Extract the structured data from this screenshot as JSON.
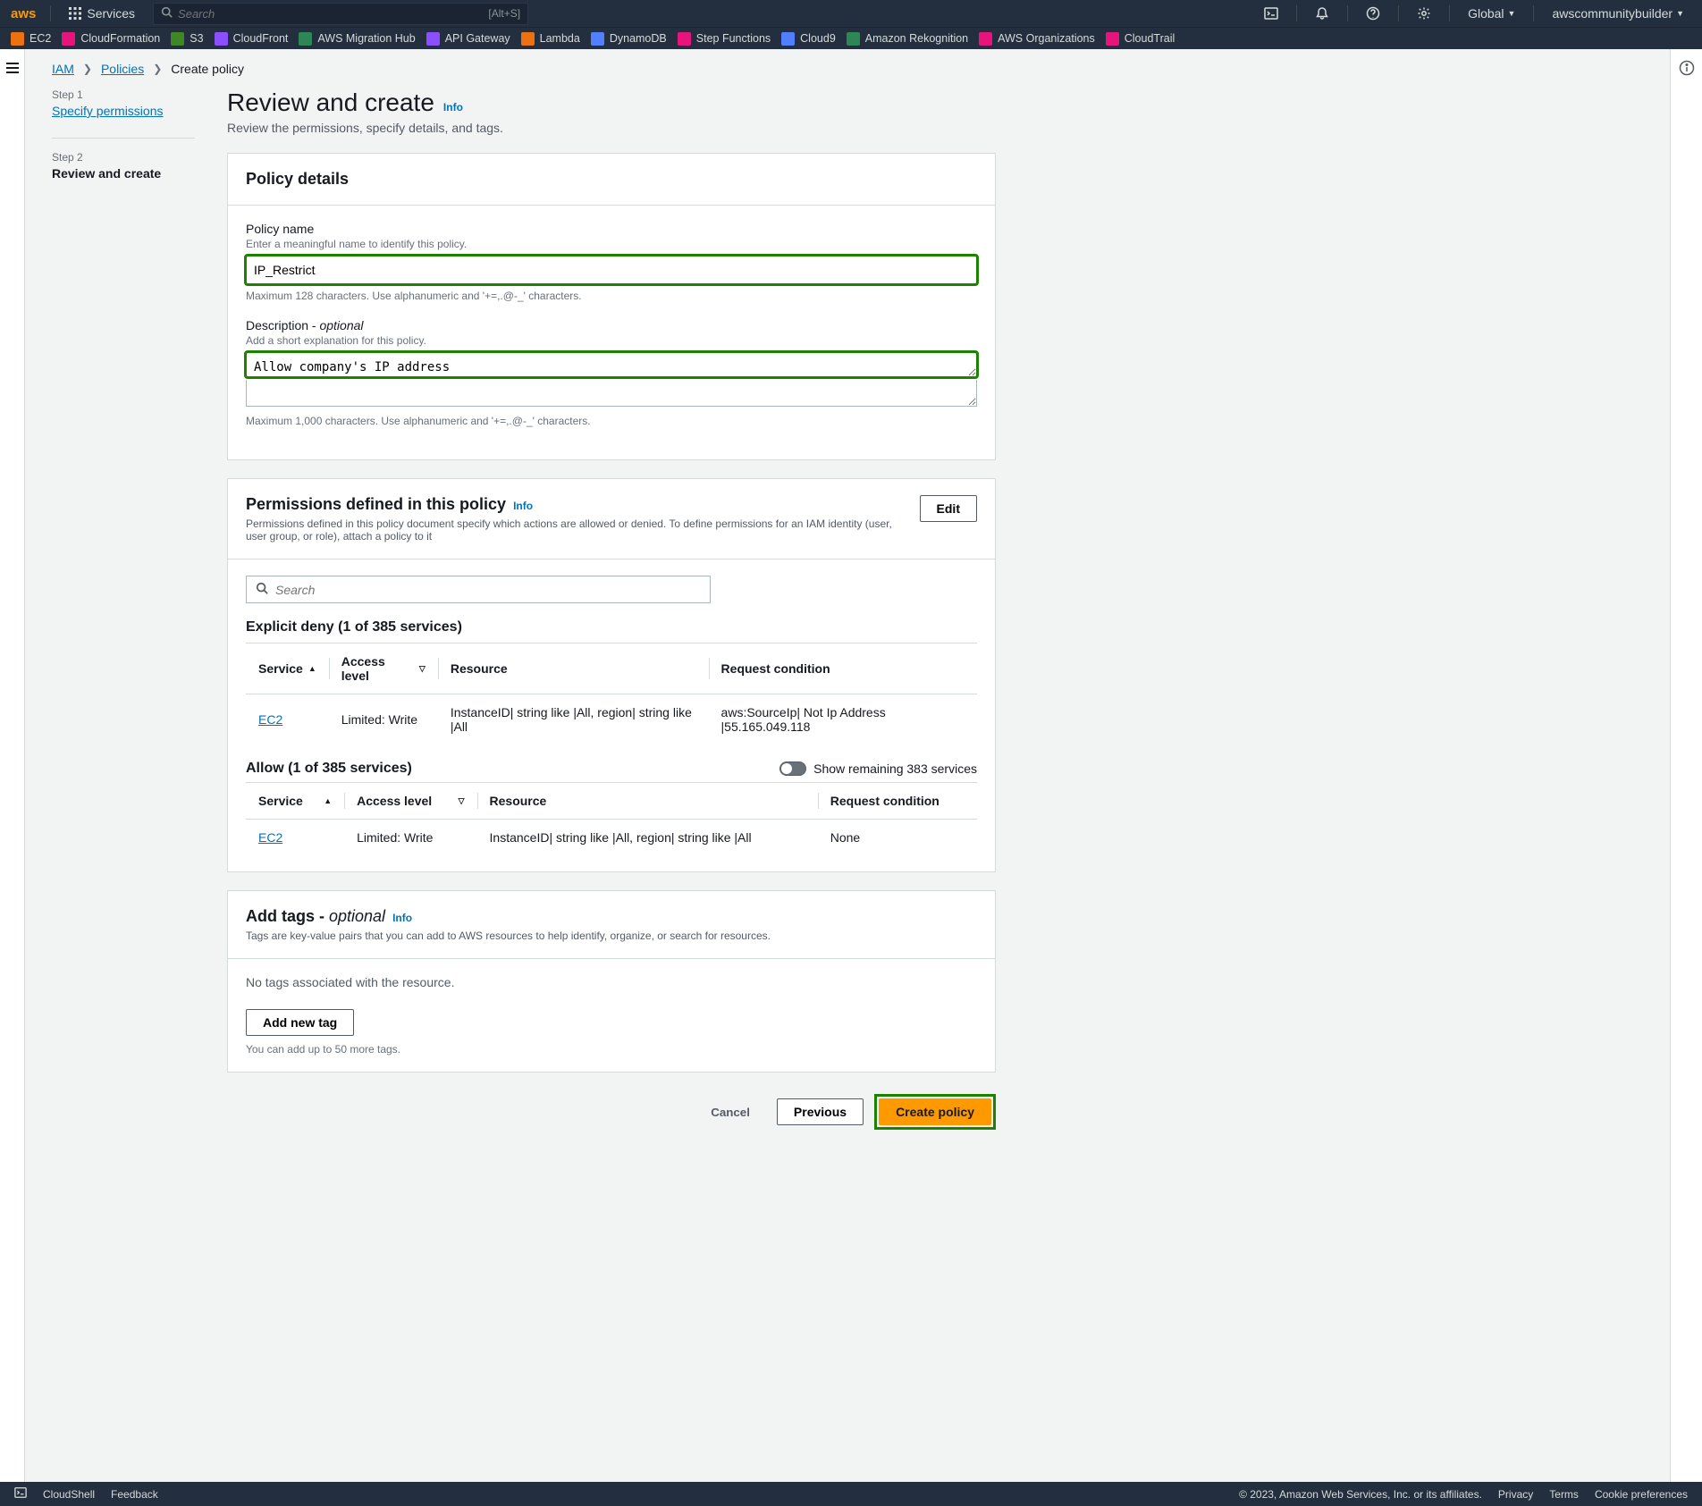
{
  "topnav": {
    "logo": "aws",
    "services": "Services",
    "search_placeholder": "Search",
    "search_shortcut": "[Alt+S]",
    "region": "Global",
    "account": "awscommunitybuilder"
  },
  "favbar": [
    {
      "label": "EC2",
      "color": "#ec7211"
    },
    {
      "label": "CloudFormation",
      "color": "#e7157b"
    },
    {
      "label": "S3",
      "color": "#3f8624"
    },
    {
      "label": "CloudFront",
      "color": "#8c4fff"
    },
    {
      "label": "AWS Migration Hub",
      "color": "#2e8555"
    },
    {
      "label": "API Gateway",
      "color": "#8c4fff"
    },
    {
      "label": "Lambda",
      "color": "#ec7211"
    },
    {
      "label": "DynamoDB",
      "color": "#527fff"
    },
    {
      "label": "Step Functions",
      "color": "#e7157b"
    },
    {
      "label": "Cloud9",
      "color": "#527fff"
    },
    {
      "label": "Amazon Rekognition",
      "color": "#2e8555"
    },
    {
      "label": "AWS Organizations",
      "color": "#e7157b"
    },
    {
      "label": "CloudTrail",
      "color": "#e7157b"
    }
  ],
  "breadcrumbs": {
    "root": "IAM",
    "mid": "Policies",
    "cur": "Create policy"
  },
  "steps": {
    "s1_label": "Step 1",
    "s1_title": "Specify permissions",
    "s2_label": "Step 2",
    "s2_title": "Review and create"
  },
  "page": {
    "title": "Review and create",
    "info": "Info",
    "subtitle": "Review the permissions, specify details, and tags."
  },
  "details": {
    "heading": "Policy details",
    "name_label": "Policy name",
    "name_hint": "Enter a meaningful name to identify this policy.",
    "name_value": "IP_Restrict",
    "name_constraint": "Maximum 128 characters. Use alphanumeric and '+=,.@-_' characters.",
    "desc_label": "Description - ",
    "desc_opt": "optional",
    "desc_hint": "Add a short explanation for this policy.",
    "desc_value": "Allow company's IP address",
    "desc_constraint": "Maximum 1,000 characters. Use alphanumeric and '+=,.@-_' characters."
  },
  "perm": {
    "heading": "Permissions defined in this policy",
    "info": "Info",
    "desc": "Permissions defined in this policy document specify which actions are allowed or denied. To define permissions for an IAM identity (user, user group, or role), attach a policy to it",
    "edit": "Edit",
    "search_placeholder": "Search",
    "deny_heading": "Explicit deny (1 of 385 services)",
    "cols": {
      "service": "Service",
      "access": "Access level",
      "resource": "Resource",
      "cond": "Request condition"
    },
    "deny_row": {
      "service": "EC2",
      "access": "Limited: Write",
      "resource": "InstanceID| string like |All, region| string like |All",
      "cond": "aws:SourceIp| Not Ip Address |55.165.049.118"
    },
    "allow_heading": "Allow (1 of 385 services)",
    "toggle_label": "Show remaining 383 services",
    "allow_row": {
      "service": "EC2",
      "access": "Limited: Write",
      "resource": "InstanceID| string like |All, region| string like |All",
      "cond": "None"
    }
  },
  "tags": {
    "heading": "Add tags - ",
    "opt": "optional",
    "info": "Info",
    "desc": "Tags are key-value pairs that you can add to AWS resources to help identify, organize, or search for resources.",
    "none": "No tags associated with the resource.",
    "add": "Add new tag",
    "hint": "You can add up to 50 more tags."
  },
  "actions": {
    "cancel": "Cancel",
    "previous": "Previous",
    "create": "Create policy"
  },
  "footer": {
    "cloudshell": "CloudShell",
    "feedback": "Feedback",
    "copyright": "© 2023, Amazon Web Services, Inc. or its affiliates.",
    "privacy": "Privacy",
    "terms": "Terms",
    "cookies": "Cookie preferences"
  }
}
